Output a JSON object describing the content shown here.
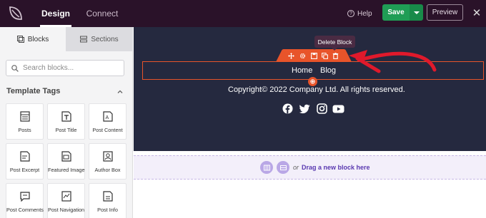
{
  "colors": {
    "topbar_bg": "#2a1229",
    "accent_orange": "#e8542a",
    "save_green": "#1f9d55",
    "canvas_dark": "#25293f",
    "annotation_red": "#e0192b",
    "drop_purple": "#5a39b0"
  },
  "topbar": {
    "logo": "seedprod-leaf-icon",
    "tabs": [
      {
        "label": "Design",
        "active": true
      },
      {
        "label": "Connect",
        "active": false
      }
    ],
    "help_label": "Help",
    "save_label": "Save",
    "preview_label": "Preview"
  },
  "sidebar": {
    "tabs": [
      {
        "label": "Blocks",
        "icon": "blocks-icon",
        "active": true
      },
      {
        "label": "Sections",
        "icon": "sections-icon",
        "active": false
      }
    ],
    "search_placeholder": "Search blocks...",
    "group_title": "Template Tags",
    "blocks": [
      {
        "label": "Posts",
        "icon": "posts-icon"
      },
      {
        "label": "Post Title",
        "icon": "post-title-icon"
      },
      {
        "label": "Post Content",
        "icon": "post-content-icon"
      },
      {
        "label": "Post Excerpt",
        "icon": "post-excerpt-icon"
      },
      {
        "label": "Featured Image",
        "icon": "featured-image-icon"
      },
      {
        "label": "Author Box",
        "icon": "author-box-icon"
      },
      {
        "label": "Post Comments",
        "icon": "post-comments-icon"
      },
      {
        "label": "Post Navigation",
        "icon": "post-navigation-icon"
      },
      {
        "label": "Post Info",
        "icon": "post-info-icon"
      }
    ]
  },
  "canvas": {
    "tooltip": "Delete Block",
    "toolbar_icons": [
      "move-icon",
      "settings-icon",
      "save-icon",
      "duplicate-icon",
      "trash-icon"
    ],
    "nav_links": [
      "Home",
      "Blog"
    ],
    "copyright": "Copyright© 2022 Company Ltd. All rights reserved.",
    "social_icons": [
      "facebook-icon",
      "twitter-icon",
      "instagram-icon",
      "youtube-icon"
    ]
  },
  "dropzone": {
    "or_label": "or",
    "drag_label": "Drag a new block here"
  }
}
